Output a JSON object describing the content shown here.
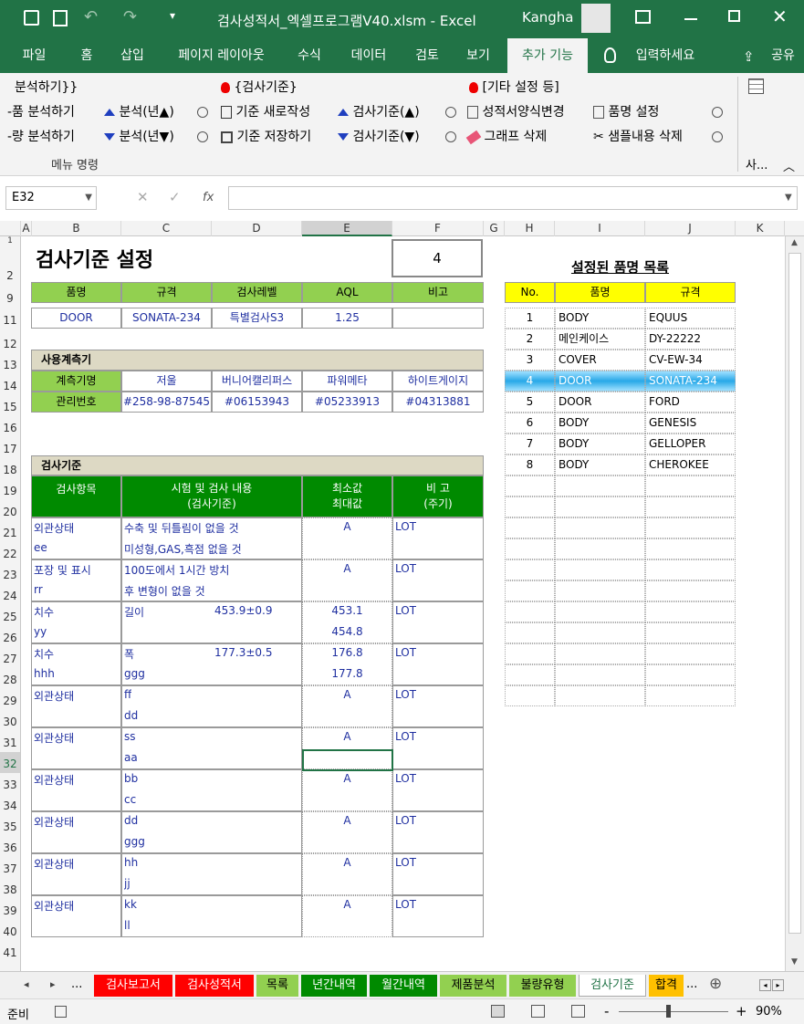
{
  "window": {
    "filename": "검사성적서_엑셀프로그램V40.xlsm",
    "separator": "-",
    "app": "Excel",
    "user": "Kangha"
  },
  "ribbon_tabs": [
    "파일",
    "홈",
    "삽입",
    "페이지 레이아웃",
    "수식",
    "데이터",
    "검토",
    "보기",
    "추가 기능",
    "입력하세요",
    "공유"
  ],
  "ribbon": {
    "row1": [
      "분석하기}}",
      "{검사기준}",
      "[기타 설정 등]"
    ],
    "row2": [
      "-품 분석하기",
      "분석(년▲)",
      "기준 새로작성",
      "검사기준(▲)",
      "성적서양식변경",
      "품명 설정"
    ],
    "row3": [
      "-량 분석하기",
      "분석(년▼)",
      "기준 저장하기",
      "검사기준(▼)",
      "그래프 삭제",
      "샘플내용 삭제"
    ],
    "group_label": "메뉴 명령",
    "overflow": "사..."
  },
  "formula_bar": {
    "name_box": "E32",
    "fx": "fx",
    "value": ""
  },
  "columns": [
    "A",
    "B",
    "C",
    "D",
    "E",
    "F",
    "G",
    "H",
    "I",
    "J",
    "K"
  ],
  "rows": [
    "1",
    "2",
    "9",
    "11",
    "12",
    "13",
    "14",
    "15",
    "16",
    "17",
    "18",
    "19",
    "20",
    "21",
    "22",
    "23",
    "24",
    "25",
    "26",
    "27",
    "28",
    "29",
    "30",
    "31",
    "32",
    "33",
    "34",
    "35",
    "36",
    "37",
    "38",
    "39",
    "40",
    "41"
  ],
  "sheet": {
    "title": "검사기준 설정",
    "number_box": "4",
    "info_headers": [
      "품명",
      "규격",
      "검사레벨",
      "AQL",
      "비고"
    ],
    "info_values": [
      "DOOR",
      "SONATA-234",
      "특별검사S3",
      "1.25",
      ""
    ],
    "gauges_title": "사용계측기",
    "gauge_label": "계측기명",
    "gauge_names": [
      "저울",
      "버니어캘리퍼스",
      "파워메타",
      "하이트게이지"
    ],
    "mgmt_label": "관리번호",
    "mgmt_numbers": [
      "#258-98-87545",
      "#06153943",
      "#05233913",
      "#04313881"
    ],
    "criteria_title": "검사기준",
    "crit_headers": {
      "item": "검사항목",
      "content1": "시험 및 검사 내용",
      "content2": "(검사기준)",
      "minmax1": "최소값",
      "minmax2": "최대값",
      "note1": "비  고",
      "note2": "(주기)"
    },
    "criteria": [
      {
        "item1": "외관상태",
        "item2": "ee",
        "c1": "수축 및 뒤틀림이 없을 것",
        "c1v": "",
        "c2": "미성형,GAS,흑점 없을 것",
        "v1": "A",
        "v2": "",
        "note": "LOT"
      },
      {
        "item1": "포장 및 표시",
        "item2": "rr",
        "c1": "100도에서 1시간 방치",
        "c1v": "",
        "c2": "후 변형이 없을 것",
        "v1": "A",
        "v2": "",
        "note": "LOT"
      },
      {
        "item1": "치수",
        "item2": "yy",
        "c1": "길이",
        "c1v": "453.9±0.9",
        "c2": "",
        "v1": "453.1",
        "v2": "454.8",
        "note": "LOT"
      },
      {
        "item1": "치수",
        "item2": "hhh",
        "c1": "폭",
        "c1v": "177.3±0.5",
        "c2": "ggg",
        "v1": "176.8",
        "v2": "177.8",
        "note": "LOT"
      },
      {
        "item1": "외관상태",
        "item2": "",
        "c1": "ff",
        "c1v": "",
        "c2": "dd",
        "v1": "A",
        "v2": "",
        "note": "LOT"
      },
      {
        "item1": "외관상태",
        "item2": "",
        "c1": "ss",
        "c1v": "",
        "c2": "aa",
        "v1": "A",
        "v2": "",
        "note": "LOT"
      },
      {
        "item1": "외관상태",
        "item2": "",
        "c1": "bb",
        "c1v": "",
        "c2": "cc",
        "v1": "A",
        "v2": "",
        "note": "LOT"
      },
      {
        "item1": "외관상태",
        "item2": "",
        "c1": "dd",
        "c1v": "",
        "c2": "ggg",
        "v1": "A",
        "v2": "",
        "note": "LOT"
      },
      {
        "item1": "외관상태",
        "item2": "",
        "c1": "hh",
        "c1v": "",
        "c2": "jj",
        "v1": "A",
        "v2": "",
        "note": "LOT"
      },
      {
        "item1": "외관상태",
        "item2": "",
        "c1": "kk",
        "c1v": "",
        "c2": "ll",
        "v1": "A",
        "v2": "",
        "note": "LOT"
      }
    ],
    "product_list_title": "설정된 품명 목록",
    "product_headers": [
      "No.",
      "품명",
      "규격"
    ],
    "products": [
      {
        "no": "1",
        "name": "BODY",
        "spec": "EQUUS"
      },
      {
        "no": "2",
        "name": "메인케이스",
        "spec": "DY-22222"
      },
      {
        "no": "3",
        "name": "COVER",
        "spec": "CV-EW-34"
      },
      {
        "no": "4",
        "name": "DOOR",
        "spec": "SONATA-234"
      },
      {
        "no": "5",
        "name": "DOOR",
        "spec": "FORD"
      },
      {
        "no": "6",
        "name": "BODY",
        "spec": "GENESIS"
      },
      {
        "no": "7",
        "name": "BODY",
        "spec": "GELLOPER"
      },
      {
        "no": "8",
        "name": "BODY",
        "spec": "CHEROKEE"
      }
    ],
    "selected_product": "4"
  },
  "sheet_tabs": [
    {
      "label": "검사보고서",
      "color": "#ff0000"
    },
    {
      "label": "검사성적서",
      "color": "#ff0000"
    },
    {
      "label": "목록",
      "color": "#92d050"
    },
    {
      "label": "년간내역",
      "color": "#008a00"
    },
    {
      "label": "월간내역",
      "color": "#008a00"
    },
    {
      "label": "제품분석",
      "color": "#92d050"
    },
    {
      "label": "불량유형",
      "color": "#92d050"
    },
    {
      "label": "검사기준",
      "color": "#ffffff"
    },
    {
      "label": "합격",
      "color": "#ffc000"
    }
  ],
  "sheet_nav": {
    "more": "...",
    "more2": "...",
    "add": "⊕"
  },
  "status": {
    "ready": "준비",
    "zoom": "90%",
    "minus": "-",
    "plus": "+"
  }
}
